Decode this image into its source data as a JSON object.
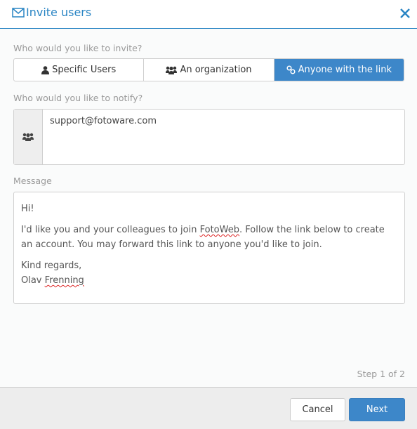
{
  "header": {
    "title": "Invite users",
    "title_icon": "envelope-icon",
    "close_icon": "close-icon",
    "accent_color": "#2a85c4"
  },
  "invite": {
    "label": "Who would you like to invite?",
    "options": [
      {
        "label": "Specific Users",
        "icon": "user-icon",
        "selected": false
      },
      {
        "label": "An organization",
        "icon": "users-icon",
        "selected": false
      },
      {
        "label": "Anyone with the link",
        "icon": "link-icon",
        "selected": true
      }
    ],
    "selected_color": "#3d87c9"
  },
  "notify": {
    "label": "Who would you like to notify?",
    "icon": "users-icon",
    "value": "support@fotoware.com"
  },
  "message": {
    "label": "Message",
    "greeting": "Hi!",
    "body_before": "I'd like you and your colleagues to join ",
    "body_word": "FotoWeb",
    "body_after": ". Follow the link below to create an account. You may forward this link to anyone you'd like to join.",
    "closing": "Kind regards,",
    "signature_first": "Olav ",
    "signature_last": "Frenning"
  },
  "step": "Step 1 of 2",
  "footer": {
    "cancel_label": "Cancel",
    "next_label": "Next"
  }
}
